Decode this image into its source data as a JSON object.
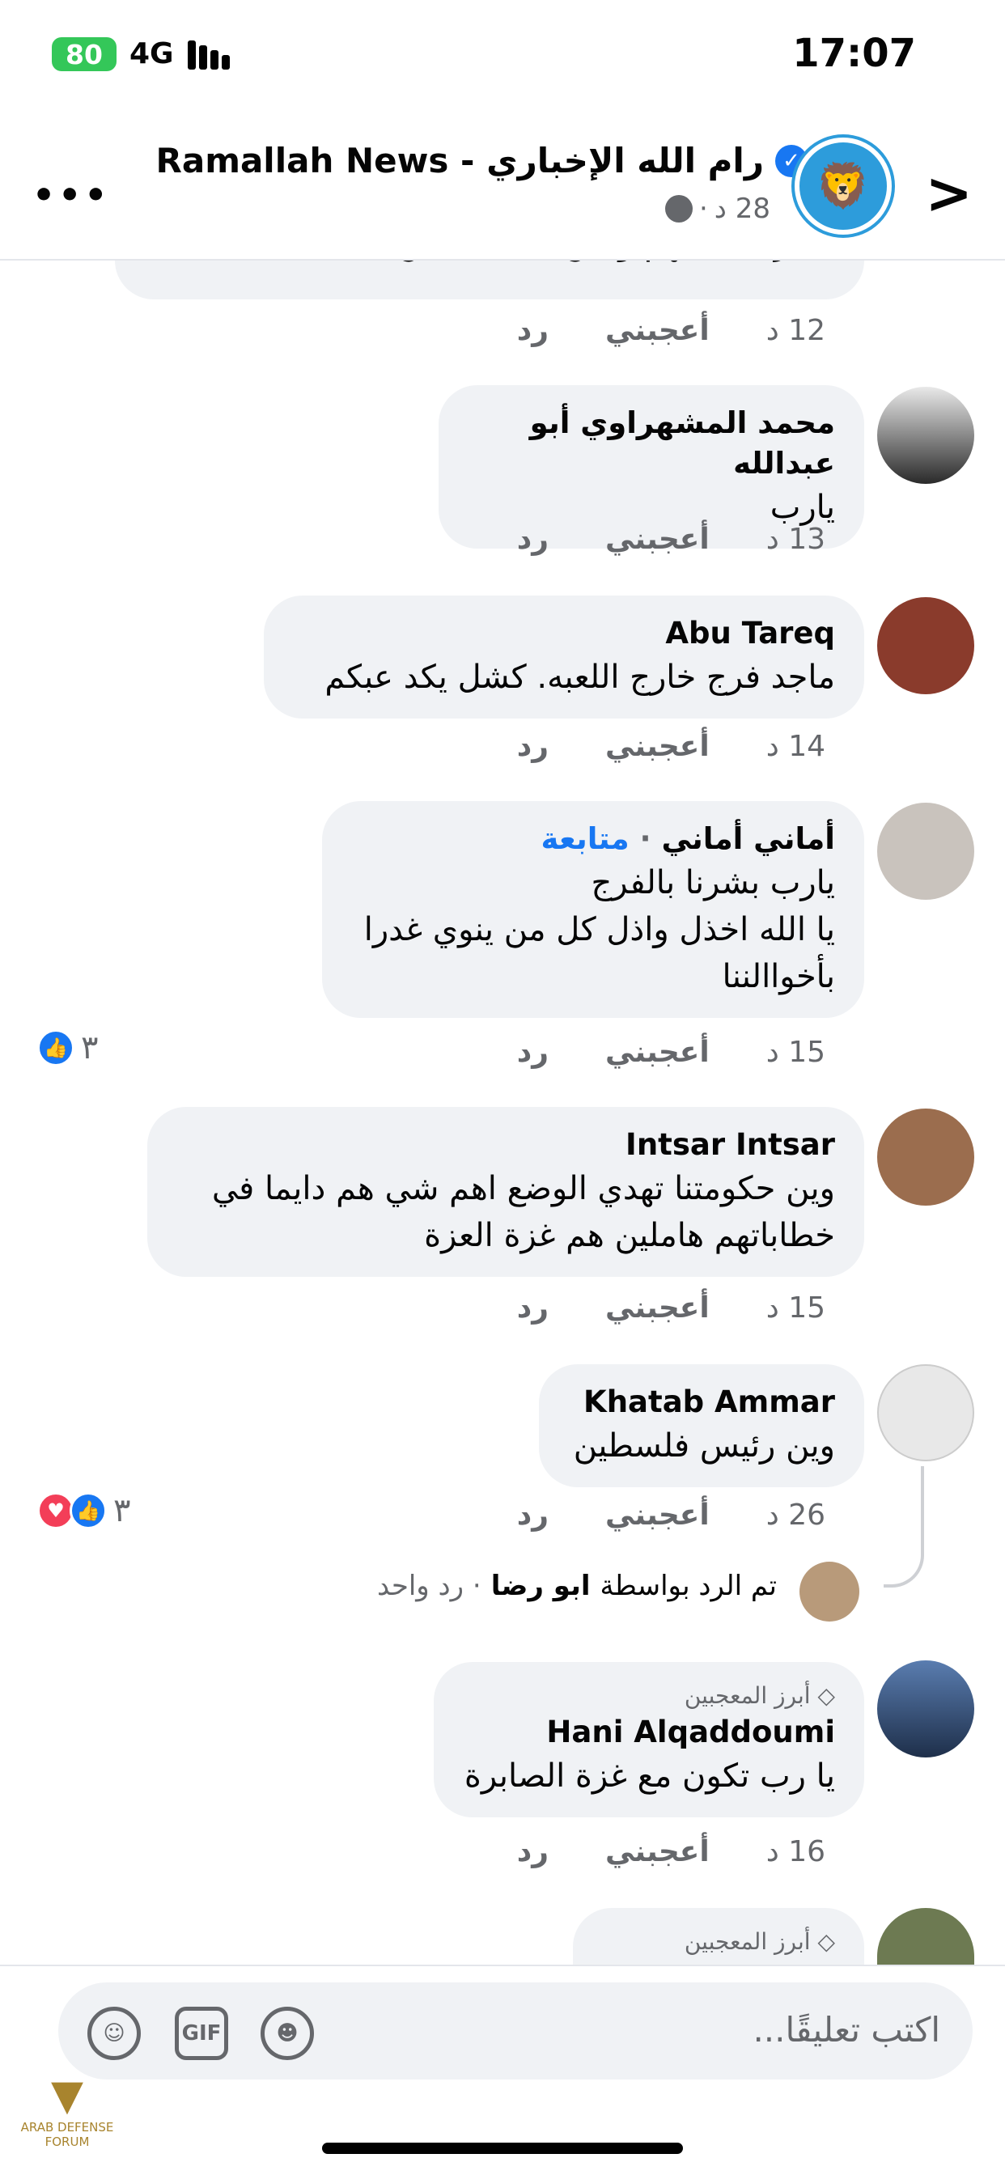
{
  "status": {
    "battery": "80",
    "network": "4G",
    "time": "17:07"
  },
  "header": {
    "title": "رام الله  الإخباري - Ramallah News",
    "verified": "✓",
    "meta_time": "28 د",
    "meta_sep": "·",
    "more": "•••",
    "back": ">"
  },
  "comments": [
    {
      "text": "فيا رب اشفهم ونحن الضعفاء من عبادك",
      "time": "12 د",
      "like": "أعجبني",
      "reply": "رد"
    },
    {
      "name": "محمد المشهراوي أبو عبدالله",
      "text": "يارب",
      "time": "13 د",
      "like": "أعجبني",
      "reply": "رد"
    },
    {
      "name": "Abu Tareq",
      "text": "ماجد فرج خارج اللعبه. كشل يكد عبكم",
      "time": "14 د",
      "like": "أعجبني",
      "reply": "رد"
    },
    {
      "name": "أماني  أماني",
      "follow": "متابعة",
      "text1": "يارب بشرنا بالفرج",
      "text2": "يا الله اخذل واذل كل من ينوي غدرا",
      "text3": "بأخواالننا",
      "time": "15 د",
      "like": "أعجبني",
      "reply": "رد",
      "reactions": "٣"
    },
    {
      "name": "Intsar Intsar",
      "text1": "وين حكومتنا تهدي الوضع اهم شي هم دايما في",
      "text2": "خطاباتهم هاملين هم غزة العزة",
      "time": "15 د",
      "like": "أعجبني",
      "reply": "رد"
    },
    {
      "name": "Khatab Ammar",
      "text": "وين رئيس فلسطين",
      "time": "26 د",
      "like": "أعجبني",
      "reply": "رد",
      "reactions": "٣"
    },
    {
      "badge": "أبرز المعجبين",
      "name": "Hani Alqaddoumi",
      "text": "يا رب تكون مع غزة الصابرة",
      "time": "16 د",
      "like": "أعجبني",
      "reply": "رد"
    },
    {
      "badge": "أبرز المعجبين"
    }
  ],
  "replied": {
    "prefix": "تم الرد بواسطة",
    "name": "ابو رضا",
    "suffix": "· رد واحد"
  },
  "composer": {
    "placeholder": "اكتب تعليقًا...",
    "gif": "GIF"
  },
  "watermark": {
    "text": "ARAB DEFENSE FORUM"
  }
}
